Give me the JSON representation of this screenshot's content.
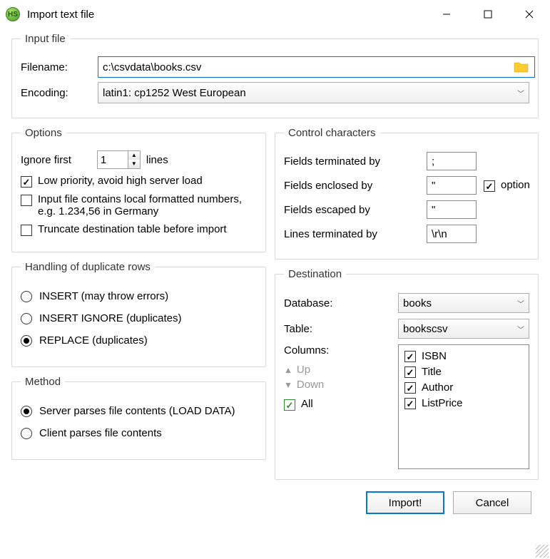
{
  "window": {
    "title": "Import text file"
  },
  "inputFile": {
    "legend": "Input file",
    "filenameLabel": "Filename:",
    "filenameValue": "c:\\csvdata\\books.csv",
    "encodingLabel": "Encoding:",
    "encodingValue": "latin1: cp1252 West European"
  },
  "options": {
    "legend": "Options",
    "ignorePrefix": "Ignore first",
    "ignoreValue": "1",
    "ignoreSuffix": "lines",
    "lowPriority": "Low priority, avoid high server load",
    "localNumbers": "Input file contains local formatted numbers, e.g. 1.234,56 in Germany",
    "truncate": "Truncate destination table before import"
  },
  "control": {
    "legend": "Control characters",
    "fieldsTerm": "Fields terminated by",
    "fieldsTermVal": ";",
    "fieldsEnc": "Fields enclosed by",
    "fieldsEncVal": "\"",
    "optional": "optionally",
    "fieldsEsc": "Fields escaped by",
    "fieldsEscVal": "\"",
    "linesTerm": "Lines terminated by",
    "linesTermVal": "\\r\\n"
  },
  "dup": {
    "legend": "Handling of duplicate rows",
    "insert": "INSERT (may throw errors)",
    "insertIgnore": "INSERT IGNORE (duplicates)",
    "replace": "REPLACE (duplicates)"
  },
  "dest": {
    "legend": "Destination",
    "dbLabel": "Database:",
    "dbVal": "books",
    "tableLabel": "Table:",
    "tableVal": "bookscsv",
    "colsLabel": "Columns:",
    "up": "Up",
    "down": "Down",
    "all": "All",
    "columns": [
      "ISBN",
      "Title",
      "Author",
      "ListPrice"
    ]
  },
  "method": {
    "legend": "Method",
    "server": "Server parses file contents (LOAD DATA)",
    "client": "Client parses file contents"
  },
  "buttons": {
    "import": "Import!",
    "cancel": "Cancel"
  }
}
